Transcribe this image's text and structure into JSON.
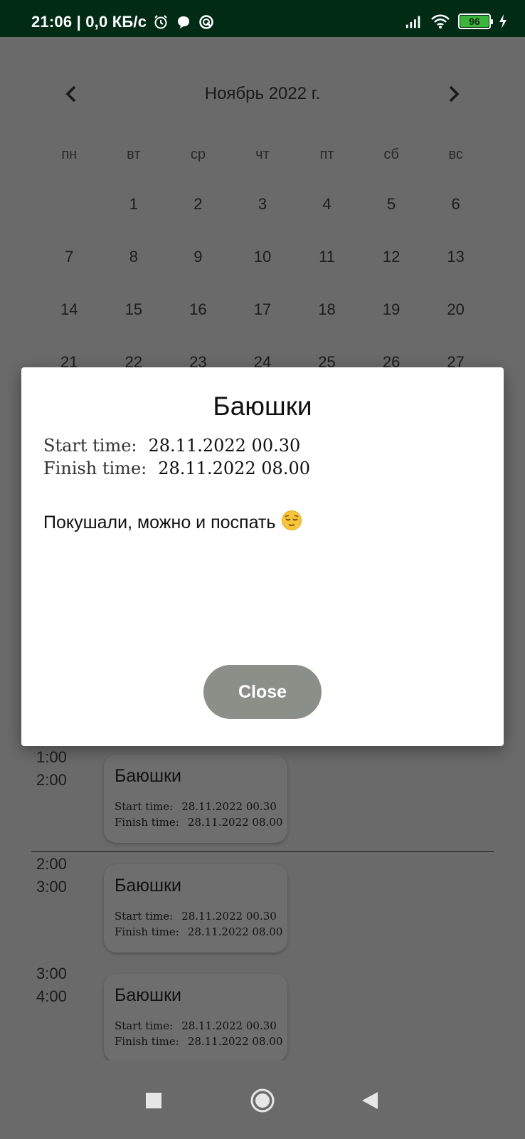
{
  "status_bar": {
    "time": "21:06 | 0,0 КБ/с",
    "battery": "96",
    "icons": [
      "alarm-icon",
      "chat-icon",
      "sync-icon",
      "signal-icon",
      "wifi-icon",
      "battery-icon",
      "charging-icon"
    ]
  },
  "calendar": {
    "title": "Ноябрь 2022 г.",
    "weekdays": [
      "пн",
      "вт",
      "ср",
      "чт",
      "пт",
      "сб",
      "вс"
    ],
    "weeks": [
      [
        "",
        "1",
        "2",
        "3",
        "4",
        "5",
        "6"
      ],
      [
        "7",
        "8",
        "9",
        "10",
        "11",
        "12",
        "13"
      ],
      [
        "14",
        "15",
        "16",
        "17",
        "18",
        "19",
        "20"
      ],
      [
        "21",
        "22",
        "23",
        "24",
        "25",
        "26",
        "27"
      ]
    ]
  },
  "dialog": {
    "title": "Баюшки",
    "start_label": "Start time:",
    "start_value": "28.11.2022 00.30",
    "finish_label": "Finish time:",
    "finish_value": "28.11.2022 08.00",
    "description": "Покушали, можно и поспать",
    "emoji": "😌",
    "close_label": "Close"
  },
  "schedule": {
    "slots": [
      {
        "from": "1:00",
        "to": "2:00",
        "event": {
          "title": "Баюшки",
          "start_label": "Start time:",
          "start_value": "28.11.2022 00.30",
          "finish_label": "Finish time:",
          "finish_value": "28.11.2022 08.00"
        }
      },
      {
        "from": "2:00",
        "to": "3:00",
        "event": {
          "title": "Баюшки",
          "start_label": "Start time:",
          "start_value": "28.11.2022 00.30",
          "finish_label": "Finish time:",
          "finish_value": "28.11.2022 08.00"
        }
      },
      {
        "from": "3:00",
        "to": "4:00",
        "event": {
          "title": "Баюшки",
          "start_label": "Start time:",
          "start_value": "28.11.2022 00.30",
          "finish_label": "Finish time:",
          "finish_value": "28.11.2022 08.00"
        }
      }
    ]
  },
  "colors": {
    "status_bar": "#012b15",
    "scrim_bg": "#6a6a6a",
    "close_button": "#8a8f88",
    "battery": "#3db43b"
  }
}
